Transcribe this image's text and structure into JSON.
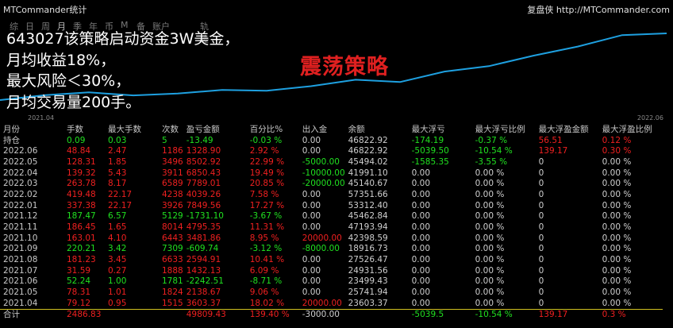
{
  "header": {
    "app_title": "MTCommander统计",
    "site_label": "复盘侠 http://MTCommander.com"
  },
  "tabs": [
    {
      "label": "综",
      "active": false
    },
    {
      "label": "日",
      "active": false
    },
    {
      "label": "周",
      "active": false
    },
    {
      "label": "月",
      "active": true
    },
    {
      "label": "季",
      "active": false
    },
    {
      "label": "年",
      "active": false
    },
    {
      "label": "币",
      "active": false
    },
    {
      "label": "M",
      "active": false
    },
    {
      "label": "备",
      "active": false
    },
    {
      "label": "账户",
      "active": false,
      "wide": true
    },
    {
      "label": "轨迹",
      "active": false
    }
  ],
  "overlay_lines": [
    "643027该策略启动资金3W美金，",
    "月均收益18%，",
    "最大风险＜30%，",
    "月均交易量200手。"
  ],
  "strategy_label": "震荡策略",
  "chart": {
    "date_start": "2021.04",
    "date_end": "2022.06",
    "line_color": "#1ea0e0"
  },
  "table": {
    "columns": [
      "月份",
      "手数",
      "最大手数",
      "次数",
      "盈亏金额",
      "百分比%",
      "出入金",
      "余额",
      "最大浮亏",
      "最大浮亏比例",
      "最大浮盈金额",
      "最大浮盈比例"
    ],
    "rows": [
      {
        "cells": [
          "持仓",
          "0.09",
          "0.03",
          "5",
          "-13.49",
          "-0.03 %",
          "0.00",
          "46822.92",
          "-174.19",
          "-0.37 %",
          "56.51",
          "0.12 %"
        ],
        "tone": "g",
        "tail": "r"
      },
      {
        "cells": [
          "2022.06",
          "48.84",
          "2.47",
          "1186",
          "1328.90",
          "2.92 %",
          "0.00",
          "46822.92",
          "-5039.50",
          "-10.54 %",
          "139.17",
          "0.30 %"
        ],
        "tone": "r",
        "tail": "mixed"
      },
      {
        "cells": [
          "2022.05",
          "128.31",
          "1.85",
          "3496",
          "8502.92",
          "22.99 %",
          "-5000.00",
          "45494.02",
          "-1585.35",
          "-3.55 %",
          "0",
          "0.00 %"
        ],
        "tone": "r"
      },
      {
        "cells": [
          "2022.04",
          "139.32",
          "5.43",
          "3911",
          "6850.43",
          "19.49 %",
          "-10000.00",
          "41991.10",
          "0.00",
          "0.00 %",
          "0",
          "0.00 %"
        ],
        "tone": "r"
      },
      {
        "cells": [
          "2022.03",
          "263.78",
          "8.17",
          "6589",
          "7789.01",
          "20.85 %",
          "-20000.00",
          "45140.67",
          "0.00",
          "0.00 %",
          "0",
          "0.00 %"
        ],
        "tone": "r"
      },
      {
        "cells": [
          "2022.02",
          "419.48",
          "22.17",
          "4238",
          "4039.26",
          "7.58 %",
          "0.00",
          "57351.66",
          "0.00",
          "0.00 %",
          "0",
          "0.00 %"
        ],
        "tone": "r"
      },
      {
        "cells": [
          "2022.01",
          "337.38",
          "22.17",
          "3926",
          "7849.56",
          "17.27 %",
          "0.00",
          "53312.40",
          "0.00",
          "0.00 %",
          "0",
          "0.00 %"
        ],
        "tone": "r"
      },
      {
        "cells": [
          "2021.12",
          "187.47",
          "6.57",
          "5129",
          "-1731.10",
          "-3.67 %",
          "0.00",
          "45462.84",
          "0.00",
          "0.00 %",
          "0",
          "0.00 %"
        ],
        "tone": "g"
      },
      {
        "cells": [
          "2021.11",
          "186.45",
          "1.65",
          "8014",
          "4795.35",
          "11.31 %",
          "0.00",
          "47193.94",
          "0.00",
          "0.00 %",
          "0",
          "0.00 %"
        ],
        "tone": "r"
      },
      {
        "cells": [
          "2021.10",
          "163.01",
          "4.10",
          "6443",
          "3481.86",
          "8.95 %",
          "20000.00",
          "42398.59",
          "0.00",
          "0.00 %",
          "0",
          "0.00 %"
        ],
        "tone": "r"
      },
      {
        "cells": [
          "2021.09",
          "220.21",
          "3.42",
          "7309",
          "-609.74",
          "-3.12 %",
          "-8000.00",
          "18916.73",
          "0.00",
          "0.00 %",
          "0",
          "0.00 %"
        ],
        "tone": "g"
      },
      {
        "cells": [
          "2021.08",
          "181.23",
          "3.45",
          "6633",
          "2594.91",
          "10.41 %",
          "0.00",
          "27526.47",
          "0.00",
          "0.00 %",
          "0",
          "0.00 %"
        ],
        "tone": "r"
      },
      {
        "cells": [
          "2021.07",
          "31.59",
          "0.27",
          "1888",
          "1432.13",
          "6.09 %",
          "0.00",
          "24931.56",
          "0.00",
          "0.00 %",
          "0",
          "0.00 %"
        ],
        "tone": "r"
      },
      {
        "cells": [
          "2021.06",
          "52.24",
          "1.00",
          "1781",
          "-2242.51",
          "-8.71 %",
          "0.00",
          "23499.43",
          "0.00",
          "0.00 %",
          "0",
          "0.00 %"
        ],
        "tone": "g"
      },
      {
        "cells": [
          "2021.05",
          "78.31",
          "1.01",
          "1824",
          "2138.67",
          "9.06 %",
          "0.00",
          "25741.94",
          "0.00",
          "0.00 %",
          "0",
          "0.00 %"
        ],
        "tone": "r"
      },
      {
        "cells": [
          "2021.04",
          "79.12",
          "0.95",
          "1515",
          "3603.37",
          "18.02 %",
          "20000.00",
          "23603.37",
          "0.00",
          "0.00 %",
          "0",
          "0.00 %"
        ],
        "tone": "r"
      }
    ],
    "total": [
      "合计",
      "2486.83",
      "",
      "",
      "49809.43",
      "139.40 %",
      "-3000.00",
      "",
      "-5039.5",
      "-10.54 %",
      "139.17",
      "0.3 %"
    ]
  }
}
